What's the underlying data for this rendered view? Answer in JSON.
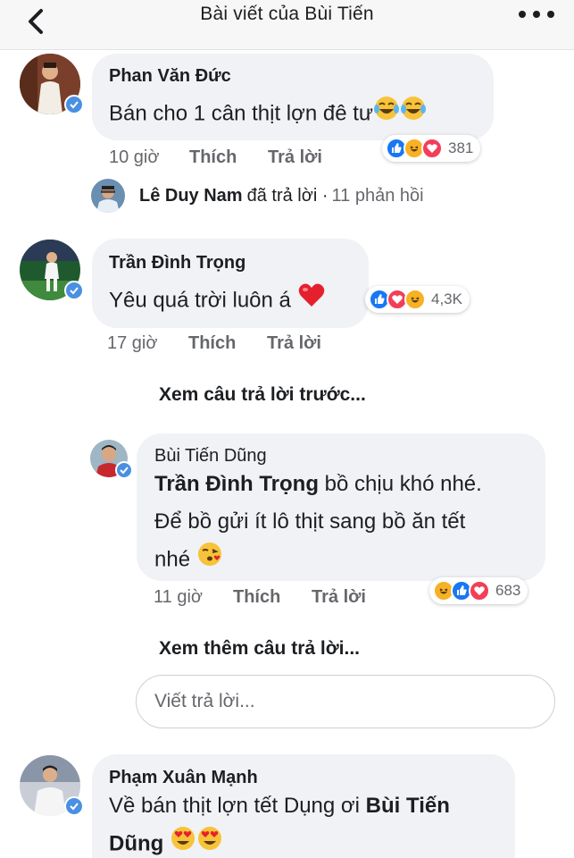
{
  "header": {
    "title": "Bài viết của Bùi Tiến",
    "back_icon": "chevron-left-icon",
    "more_icon": "more-dots-icon"
  },
  "comments": [
    {
      "author": "Phan Văn Đức",
      "text": "Bán cho 1 cân thịt lợn đê tư",
      "emoji": [
        "laughing-tears-emoji",
        "laughing-tears-emoji"
      ],
      "time": "10 giờ",
      "like_label": "Thích",
      "reply_label": "Trả lời",
      "reactions": [
        "like",
        "haha",
        "love"
      ],
      "reaction_count": "381",
      "verified": true
    },
    {
      "author": "Trần Đình Trọng",
      "text": "Yêu quá trời luôn á",
      "emoji": [
        "red-heart-emoji"
      ],
      "time": "17 giờ",
      "like_label": "Thích",
      "reply_label": "Trả lời",
      "reactions": [
        "like",
        "love",
        "haha"
      ],
      "reaction_count": "4,3K",
      "verified": true
    },
    {
      "author": "Phạm Xuân Mạnh",
      "text_before": "Về bán thịt lợn tết Dụng ơi ",
      "mention": "Bùi Tiến",
      "text_line2_mention": "Dũng",
      "emoji": [
        "heart-eyes-emoji",
        "heart-eyes-emoji"
      ],
      "verified": true
    }
  ],
  "thread": {
    "replier": "Lê Duy Nam",
    "action_text": "đã trả lời ·",
    "reply_count": "11 phản hồi"
  },
  "replies": {
    "previous_label": "Xem câu trả lời trước...",
    "more_label": "Xem thêm câu trả lời...",
    "reply": {
      "author": "Bùi Tiến Dũng",
      "mention": "Trần Đình Trọng",
      "text_line1": " bồ chịu khó nhé.",
      "text_line2": "Để bồ gửi ít lô thịt sang bồ ăn tết",
      "text_line3": "nhé",
      "emoji": [
        "kissing-heart-emoji"
      ],
      "time": "11 giờ",
      "like_label": "Thích",
      "reply_label": "Trả lời",
      "reactions": [
        "haha",
        "like",
        "love"
      ],
      "reaction_count": "683",
      "verified": true
    },
    "input_placeholder": "Viết trả lời..."
  },
  "colors": {
    "bubble": "#f0f2f5",
    "like": "#1877f2",
    "love": "#f33e58",
    "haha": "#f7b125",
    "verified": "#4a90e2",
    "meta": "#65676b"
  }
}
